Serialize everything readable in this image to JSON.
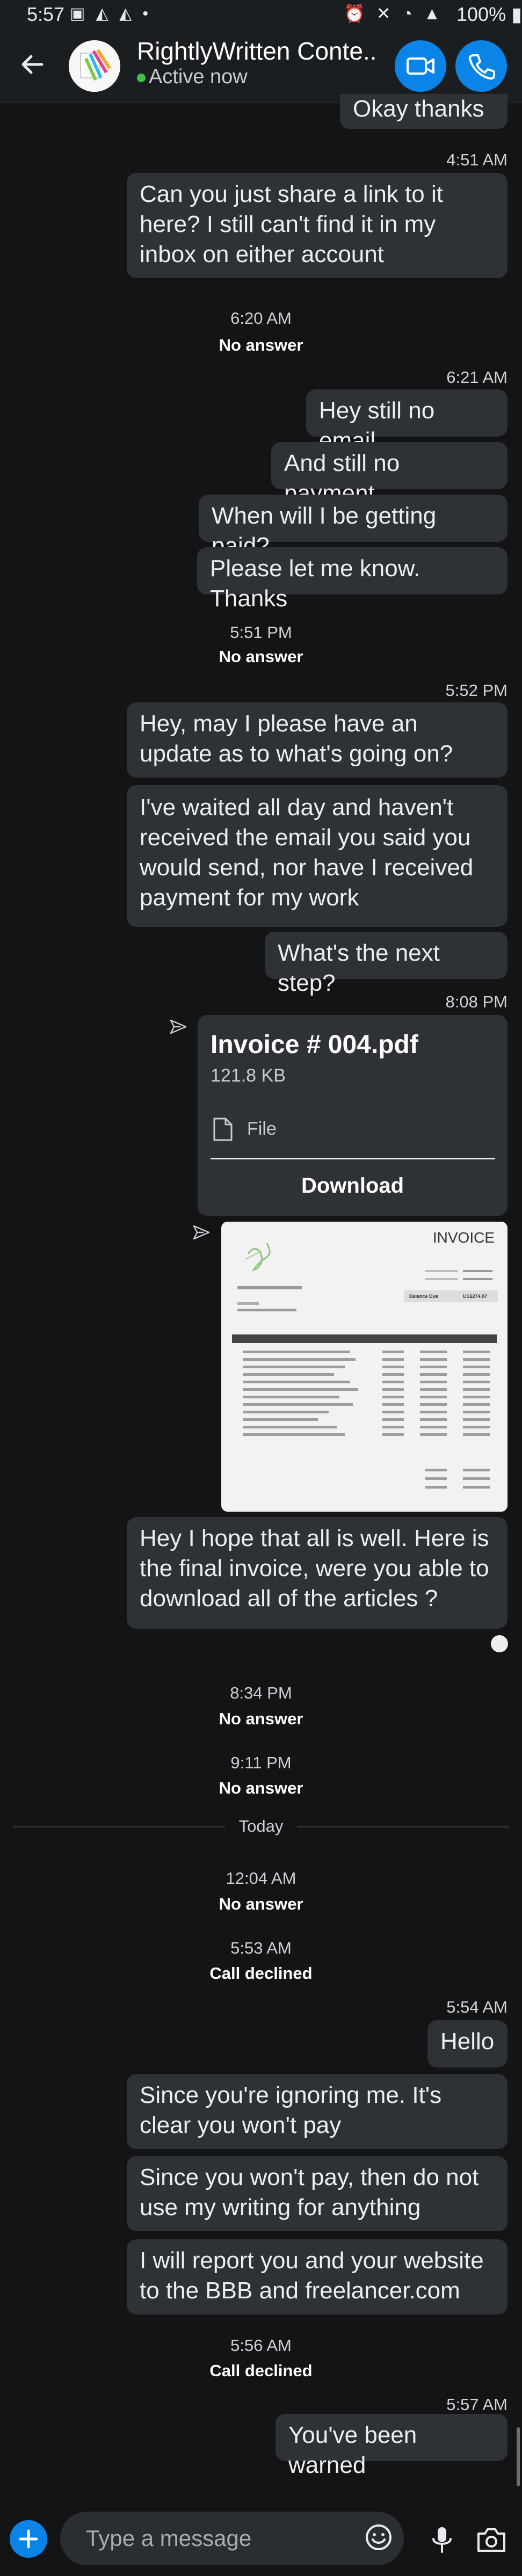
{
  "status_bar": {
    "time": "5:57",
    "battery": "100%"
  },
  "header": {
    "title": "RightlyWritten Conte...",
    "presence": "Active now"
  },
  "messages": {
    "m0": "Okay thanks",
    "t1": "4:51 AM",
    "m1": "Can you just share a link to it here? I still can't find it in my inbox on either account",
    "e1_time": "6:20 AM",
    "e1_label": "No answer",
    "t2": "6:21 AM",
    "m2": "Hey still no email",
    "m3": "And still no payment",
    "m4": "When will I be getting paid?",
    "m5": "Please let me know. Thanks",
    "e2_time": "5:51 PM",
    "e2_label": "No answer",
    "t3": "5:52 PM",
    "m6": "Hey, may I please have an update as to what's going on?",
    "m7": "I've waited all day and haven't received the email you said you would send, nor have I received payment for my work",
    "m8": "What's the next step?",
    "t4": "8:08 PM",
    "file": {
      "name": "Invoice # 004.pdf",
      "size": "121.8 KB",
      "type_label": "File",
      "download_label": "Download"
    },
    "invoice_thumb": {
      "heading": "INVOICE",
      "balance_label": "Balance Due",
      "balance_value": "US$274.07"
    },
    "m9": "Hey I hope that all is well. Here is the final invoice, were you able to download all of the articles ?",
    "e3_time": "8:34 PM",
    "e3_label": "No answer",
    "e4_time": "9:11 PM",
    "e4_label": "No answer",
    "today": "Today",
    "e5_time": "12:04 AM",
    "e5_label": "No answer",
    "e6_time": "5:53 AM",
    "e6_label": "Call declined",
    "t5": "5:54 AM",
    "m10": "Hello",
    "m11": "Since you're ignoring me. It's clear you won't pay",
    "m12": "Since you won't pay, then do not use my writing for anything",
    "m13": "I will report you and your website to the BBB and freelancer.com",
    "e7_time": "5:56 AM",
    "e7_label": "Call declined",
    "t6": "5:57 AM",
    "m14": "You've been warned"
  },
  "composer": {
    "placeholder": "Type a message"
  },
  "icons": {
    "back": "arrow-left-icon",
    "video": "video-camera-icon",
    "call": "phone-icon",
    "send": "sent-indicator-icon",
    "file": "document-icon",
    "emoji": "emoji-icon",
    "mic": "microphone-icon",
    "camera": "camera-icon",
    "add": "plus-icon"
  },
  "colors": {
    "accent": "#0a84e6",
    "bubble": "#2e3236",
    "background": "#121416",
    "online": "#3ec24a"
  }
}
